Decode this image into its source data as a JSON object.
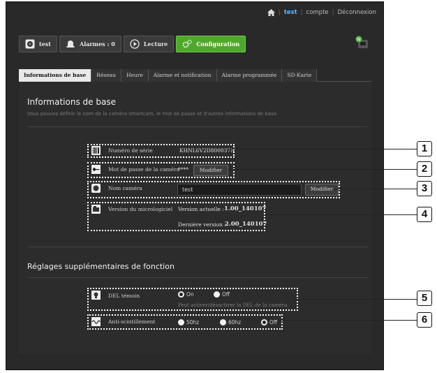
{
  "header": {
    "user": "test",
    "account": "compte",
    "logout": "Déconnexion"
  },
  "nav": [
    {
      "label": "test",
      "icon": "camera-icon"
    },
    {
      "label": "Alarmes : 0",
      "icon": "alarm-bell-icon"
    },
    {
      "label": "Lecture",
      "icon": "play-icon"
    },
    {
      "label": "Configuration",
      "icon": "gears-icon",
      "active": true
    }
  ],
  "tabs": [
    {
      "label": "Informations de base",
      "active": true
    },
    {
      "label": "Réseau"
    },
    {
      "label": "Heure"
    },
    {
      "label": "Alarme et notification"
    },
    {
      "label": "Alarme programmée"
    },
    {
      "label": "SD-Karte"
    }
  ],
  "basic": {
    "title": "Informations de base",
    "description": "Vous pouvez définir le nom de la caméra smartcam, le mot de passe et d'autres informations de base.",
    "serial_label": "Numéro de série",
    "serial_value": "KHNL6V2D800037N",
    "password_label": "Mot de passe de la caméra",
    "password_value": "****",
    "password_button": "Modifier",
    "name_label": "Nom caméra",
    "name_value": "test",
    "name_button": "Modifier",
    "firmware_label": "Version du micrologiciel",
    "current_version_label": "Version actuelle :",
    "current_version": "1.00_140107",
    "latest_version_label": "Dernière version :",
    "latest_version": "2.00_140107"
  },
  "extra": {
    "title": "Réglages supplémentaires de fonction",
    "led_label": "DEL témoin",
    "led_on": "On",
    "led_off": "Off",
    "led_hint": "Peut activer/désactiver la DEL de la caméra.",
    "flicker_label": "Anti-scintillement",
    "flicker_50": "50hz",
    "flicker_60": "60hz",
    "flicker_off": "Off"
  },
  "callouts": [
    "1",
    "2",
    "3",
    "4",
    "5",
    "6"
  ],
  "colors": {
    "accent": "#4fa82c",
    "user_link": "#57b4ff",
    "background": "#292929"
  }
}
